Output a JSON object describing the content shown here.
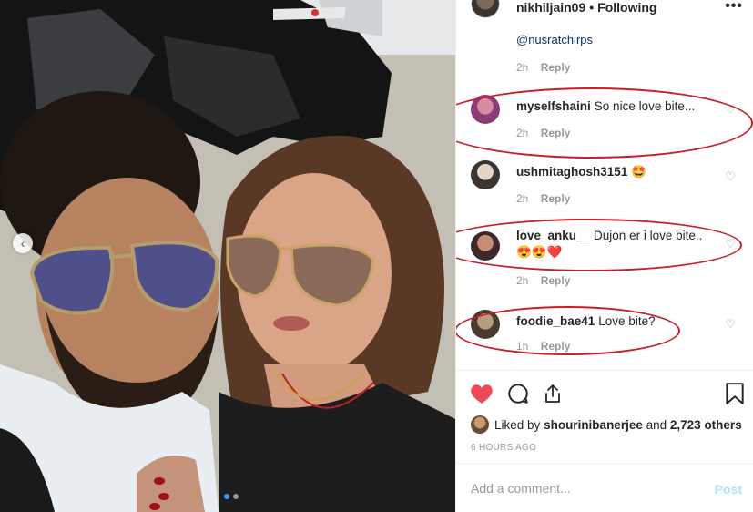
{
  "header": {
    "username": "nikhiljain09",
    "separator": "•",
    "follow_status": "Following",
    "more_icon": "more-horizontal-icon"
  },
  "comments": {
    "previous": {
      "mention": "@nusratchirps",
      "time": "2h",
      "reply": "Reply"
    },
    "items": [
      {
        "user": "myselfshaini",
        "text": "So nice love bite...",
        "time": "2h",
        "reply": "Reply",
        "highlighted": true
      },
      {
        "user": "ushmitaghosh3151",
        "text": "🤩",
        "time": "2h",
        "reply": "Reply",
        "highlighted": false
      },
      {
        "user": "love_anku__",
        "text": "Dujon er i love bite..",
        "emoji": "😍😍❤️",
        "time": "2h",
        "reply": "Reply",
        "highlighted": true
      },
      {
        "user": "foodie_bae41",
        "text": "Love bite?",
        "time": "1h",
        "reply": "Reply",
        "highlighted": true
      }
    ]
  },
  "actions": {
    "like_icon": "heart-filled-icon",
    "comment_icon": "comment-icon",
    "share_icon": "share-icon",
    "save_icon": "bookmark-icon",
    "like_color": "#ed4956"
  },
  "likes": {
    "prefix": "Liked by",
    "user": "shourinibanerjee",
    "conjunction": "and",
    "others": "2,723 others"
  },
  "timestamp": "6 HOURS AGO",
  "add_comment": {
    "placeholder": "Add a comment...",
    "post_label": "Post"
  },
  "colors": {
    "highlight_ellipse": "#c8202a",
    "link": "#003569",
    "muted": "#999999",
    "post_disabled": "#b2dffc"
  }
}
